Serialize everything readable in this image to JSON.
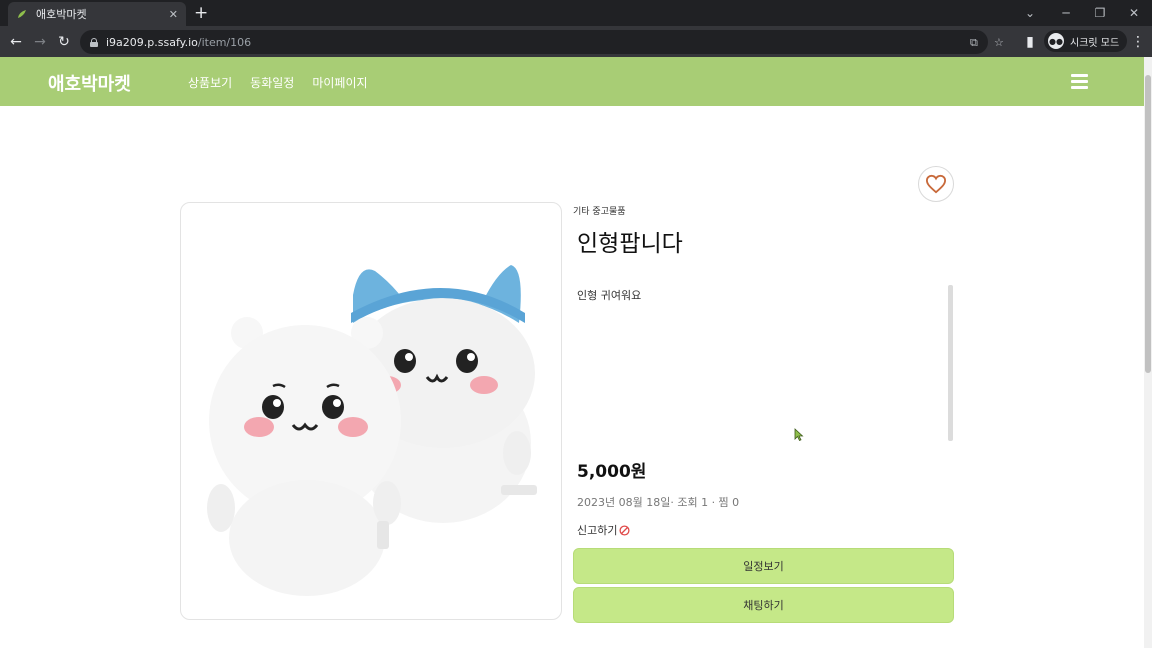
{
  "browser": {
    "tab_title": "애호박마켓",
    "tab_close": "✕",
    "new_tab": "+",
    "url_host": "i9a209.p.ssafy.io",
    "url_path": "/item/106",
    "incognito_label": "시크릿 모드",
    "icons": [
      "back-arrow-icon",
      "forward-arrow-icon",
      "reload-icon",
      "lock-icon",
      "translate-icon",
      "star-icon",
      "side-panel-icon",
      "incognito-icon",
      "menu-kebab-icon"
    ]
  },
  "site": {
    "logo": "애호박마켓",
    "nav": [
      "상품보기",
      "동화일정",
      "마이페이지"
    ],
    "header_color": "#a8cd75"
  },
  "item": {
    "category": "기타 중고물품",
    "title": "인형팝니다",
    "description": "인형 귀여워요",
    "price": "5,000원",
    "meta": "2023년 08월 18일· 조회 1 · 찜 0",
    "report_label": "신고하기",
    "schedule_button": "일정보기",
    "chat_button": "채팅하기",
    "button_color": "#c5e888"
  }
}
